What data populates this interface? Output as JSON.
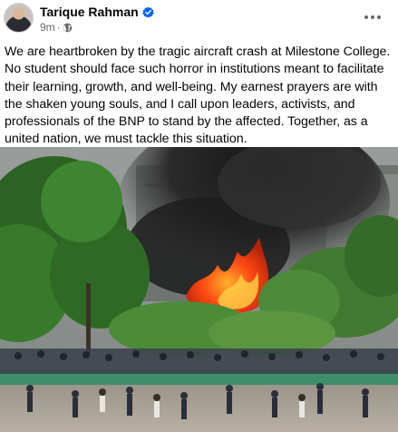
{
  "post": {
    "author": {
      "name": "Tarique Rahman",
      "verified": true,
      "verified_icon": "verified-badge-icon",
      "avatar_icon": "avatar"
    },
    "meta": {
      "time": "9m",
      "separator": "·",
      "audience_icon": "globe-icon"
    },
    "menu_icon": "more-options-icon",
    "text": "We are heartbroken by the tragic aircraft crash at Milestone College. No student should face such horror in institutions meant to facilitate their learning, growth, and well-being. My earnest prayers are with the shaken young souls, and I call upon leaders, activists, and professionals of the BNP to stand by the affected. Together, as a united nation, we must tackle this situation.",
    "photo": {
      "subject": "fire and smoke at a building behind trees, crowd gathered in the foreground",
      "colors": {
        "smoke": "#2a2a2a",
        "fire": "#ff4a12",
        "trees": "#2f6a24",
        "sky": "#8a8e90"
      }
    }
  },
  "theme": {
    "text_color": "#050505",
    "secondary_text": "#65676b",
    "verified_color": "#0866ff",
    "background": "#ffffff"
  }
}
